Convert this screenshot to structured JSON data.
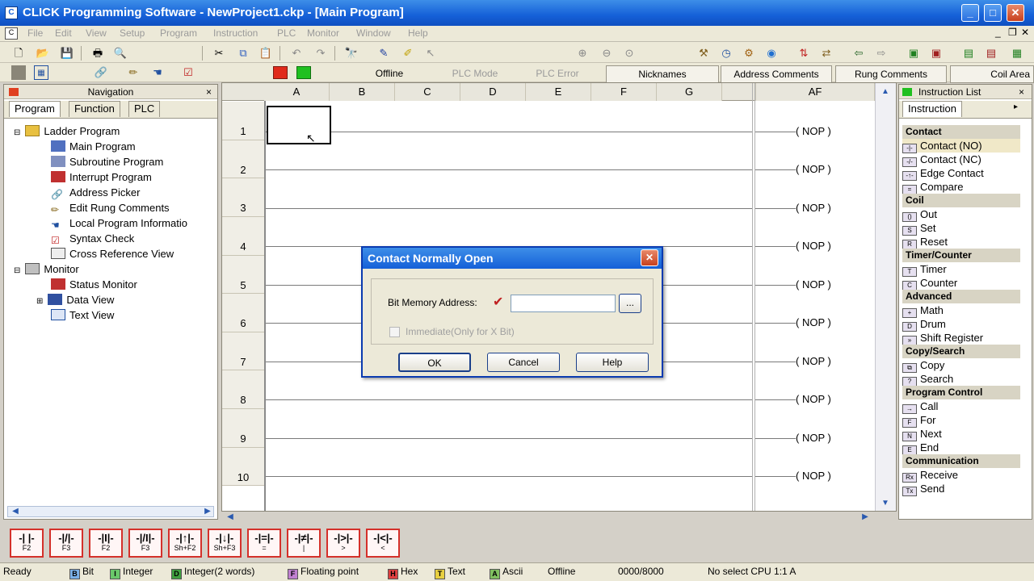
{
  "window": {
    "title": "CLICK Programming Software - NewProject1.ckp - [Main Program]"
  },
  "menu": [
    "File",
    "Edit",
    "View",
    "Setup",
    "Program",
    "Instruction",
    "PLC",
    "Monitor",
    "Window",
    "Help"
  ],
  "toolbar2": {
    "offline": "Offline",
    "plc_mode": "PLC Mode",
    "plc_error": "PLC Error",
    "nicknames": "Nicknames",
    "address_comments": "Address Comments",
    "rung_comments": "Rung Comments",
    "coil_area": "Coil Area"
  },
  "navigation": {
    "title": "Navigation",
    "tabs": [
      "Program",
      "Function",
      "PLC"
    ],
    "tree": [
      {
        "label": "Ladder Program",
        "level": 0
      },
      {
        "label": "Main Program",
        "level": 1
      },
      {
        "label": "Subroutine Program",
        "level": 1
      },
      {
        "label": "Interrupt Program",
        "level": 1
      },
      {
        "label": "Address Picker",
        "level": 1
      },
      {
        "label": "Edit Rung Comments",
        "level": 1
      },
      {
        "label": "Local Program Informatio",
        "level": 1
      },
      {
        "label": "Syntax Check",
        "level": 1
      },
      {
        "label": "Cross Reference View",
        "level": 1
      },
      {
        "label": "Monitor",
        "level": 0
      },
      {
        "label": "Status Monitor",
        "level": 1
      },
      {
        "label": "Data View",
        "level": 1
      },
      {
        "label": "Text View",
        "level": 1
      }
    ]
  },
  "ladder": {
    "columns": [
      "A",
      "B",
      "C",
      "D",
      "E",
      "F",
      "G",
      "AF"
    ],
    "rows": [
      "1",
      "2",
      "3",
      "4",
      "5",
      "6",
      "7",
      "8",
      "9",
      "10"
    ],
    "nop": "( NOP )"
  },
  "instruction_list": {
    "title": "Instruction List",
    "tab": "Instruction",
    "categories": [
      {
        "name": "Contact",
        "items": [
          "Contact (NO)",
          "Contact (NC)",
          "Edge Contact",
          "Compare"
        ]
      },
      {
        "name": "Coil",
        "items": [
          "Out",
          "Set",
          "Reset"
        ]
      },
      {
        "name": "Timer/Counter",
        "items": [
          "Timer",
          "Counter"
        ]
      },
      {
        "name": "Advanced",
        "items": [
          "Math",
          "Drum",
          "Shift Register"
        ]
      },
      {
        "name": "Copy/Search",
        "items": [
          "Copy",
          "Search"
        ]
      },
      {
        "name": "Program Control",
        "items": [
          "Call",
          "For",
          "Next",
          "End"
        ]
      },
      {
        "name": "Communication",
        "items": [
          "Receive",
          "Send"
        ]
      }
    ]
  },
  "dialog": {
    "title": "Contact Normally Open",
    "address_label": "Bit Memory Address:",
    "address_value": "",
    "browse": "...",
    "immediate": "Immediate(Only for X Bit)",
    "ok": "OK",
    "cancel": "Cancel",
    "help": "Help"
  },
  "palette": [
    "F2",
    "F3",
    "F2",
    "F3",
    "Sh+F2",
    "Sh+F3",
    "=",
    "|",
    ">",
    "<"
  ],
  "status": {
    "ready": "Ready",
    "bit": "Bit",
    "integer": "Integer",
    "integer2": "Integer(2 words)",
    "floating": "Floating point",
    "hex": "Hex",
    "text": "Text",
    "ascii": "Ascii",
    "offline": "Offline",
    "counter": "0000/8000",
    "cpu": "No select CPU  1:1 A"
  },
  "colors": {
    "titlebar": "#1560d8",
    "ladder_bg": "#ffffff",
    "palette_border": "#d4302a"
  }
}
